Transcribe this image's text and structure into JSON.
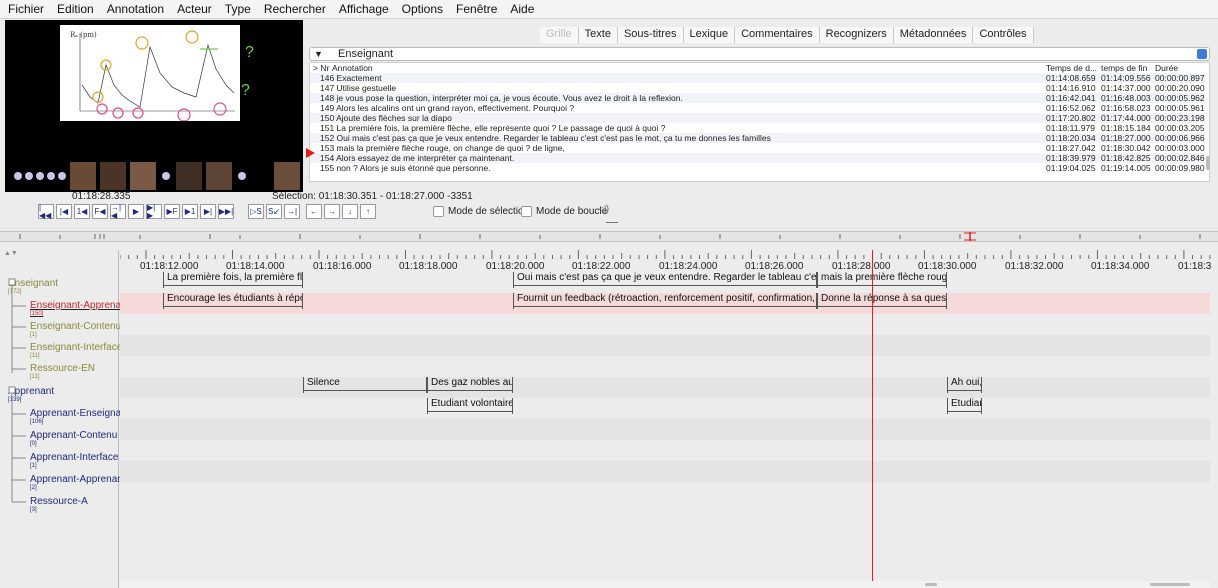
{
  "menu": [
    "Fichier",
    "Edition",
    "Annotation",
    "Acteur",
    "Type",
    "Rechercher",
    "Affichage",
    "Options",
    "Fenêtre",
    "Aide"
  ],
  "video": {
    "current_time": "01:18:28.335",
    "selection": "Sélection: 01:18:30.351 - 01:18:27.000 -3351"
  },
  "transport_buttons": [
    "|◀◀",
    "|◀",
    "1◀",
    "F◀",
    "→|◀",
    "▶",
    "▶|▶",
    "▶F",
    "▶1",
    "▶|",
    "▶▶|",
    "▷S",
    "S↙",
    "→|",
    "←",
    "→",
    "↓",
    "↑"
  ],
  "modes": {
    "selection": "Mode de sélection",
    "loop": "Mode de boucle"
  },
  "tabs": [
    "Grille",
    "Texte",
    "Sous-titres",
    "Lexique",
    "Commentaires",
    "Recognizers",
    "Métadonnées",
    "Contrôles"
  ],
  "tier_selected": "Enseignant",
  "table": {
    "headers": [
      ">  Nr",
      "Annotation",
      "Temps de d...",
      "temps de fin",
      "Durée"
    ],
    "rows": [
      {
        "text": "146 Exactement",
        "start": "01:14:08.659",
        "end": "01:14:09.556",
        "dur": "00:00:00.897"
      },
      {
        "text": "147 Utilise gestuelle",
        "start": "01:14:16.910",
        "end": "01:14:37.000",
        "dur": "00:00:20.090"
      },
      {
        "text": "148 je vous pose la question, interpréter moi ça, je vous écoute. Vous avez le droit à la reflexion.",
        "start": "01:16:42.041",
        "end": "01:16:48.003",
        "dur": "00:00:05.962"
      },
      {
        "text": "149 Alors les alcalins ont un grand rayon, effectivement. Pourquoi ?",
        "start": "01:16:52.062",
        "end": "01:16:58.023",
        "dur": "00:00:05.961"
      },
      {
        "text": "150 Ajoute des flèches sur la diapo",
        "start": "01:17:20.802",
        "end": "01:17:44.000",
        "dur": "00:00:23.198"
      },
      {
        "text": "151 La première fois, la première flèche, elle représente quoi ? Le passage de quoi à quoi ?",
        "start": "01:18:11.979",
        "end": "01:18:15.184",
        "dur": "00:00:03.205"
      },
      {
        "text": "152 Oui mais c'est pas ça que je veux entendre. Regarder le tableau c'est c'est pas le mot, ça tu me donnes les familles",
        "start": "01:18:20.034",
        "end": "01:18:27.000",
        "dur": "00:00:06.966"
      },
      {
        "text": "153 mais la première flèche rouge, on change de quoi ? de ligne,",
        "start": "01:18:27.042",
        "end": "01:18:30.042",
        "dur": "00:00:03.000"
      },
      {
        "text": "154 Alors essayez de me interpréter ça maintenant.",
        "start": "01:18:39.979",
        "end": "01:18:42.825",
        "dur": "00:00:02.846"
      },
      {
        "text": "155 non ? Alors je suis étonné que personne.",
        "start": "01:19:04.025",
        "end": "01:19:14.005",
        "dur": "00:00:09.980"
      }
    ]
  },
  "ruler_labels": [
    "01:18:12.000",
    "01:18:14.000",
    "01:18:16.000",
    "01:18:18.000",
    "01:18:20.000",
    "01:18:22.000",
    "01:18:24.000",
    "01:18:26.000",
    "01:18:28.000",
    "01:18:30.000",
    "01:18:32.000",
    "01:18:34.000",
    "01:18:3"
  ],
  "tiers": [
    {
      "name": "Enseignant",
      "count": "[172]",
      "color": "#8a8a3a"
    },
    {
      "name": "Enseignant-Apprenant",
      "count": "[150]",
      "color": "#c0262b"
    },
    {
      "name": "Enseignant-Contenu",
      "count": "[1]",
      "color": "#8a8a3a"
    },
    {
      "name": "Enseignant-Interface",
      "count": "[11]",
      "color": "#8a8a3a"
    },
    {
      "name": "Ressource-EN",
      "count": "[11]",
      "color": "#8a8a3a"
    },
    {
      "name": "Apprenant",
      "count": "[139]",
      "color": "#1f2a7a"
    },
    {
      "name": "Apprenant-Enseignant",
      "count": "[106]",
      "color": "#1f2a7a"
    },
    {
      "name": "Apprenant-Contenu",
      "count": "[0]",
      "color": "#1f2a7a"
    },
    {
      "name": "Apprenant-Interface",
      "count": "[1]",
      "color": "#1f2a7a"
    },
    {
      "name": "Apprenant-Apprenant",
      "count": "[2]",
      "color": "#1f2a7a"
    },
    {
      "name": "Ressource-A",
      "count": "[3]",
      "color": "#1f2a7a"
    }
  ],
  "annotations": {
    "enseignant": [
      "La première fois, la première flèche, el",
      "Oui mais c'est pas ça que je veux entendre. Regarder le tableau c'est c'est pas le m",
      "mais la première flèche rouge, on c"
    ],
    "enseignant_apprenant": [
      "Encourage les étudiants à répondre a",
      "Fournit un feedback (rétroaction, renforcement positif, confirmation, infirmation)",
      "Donne la réponse à sa question"
    ],
    "apprenant": [
      "Silence",
      "Des gaz nobles aux al",
      "Ah oui, o"
    ],
    "apprenant_enseignant": [
      "Etudiant volontaire rép",
      "Etudiant f"
    ]
  },
  "slide_axis_label": "Rₐ (pm)",
  "video_qmarks": [
    "?",
    "?"
  ]
}
